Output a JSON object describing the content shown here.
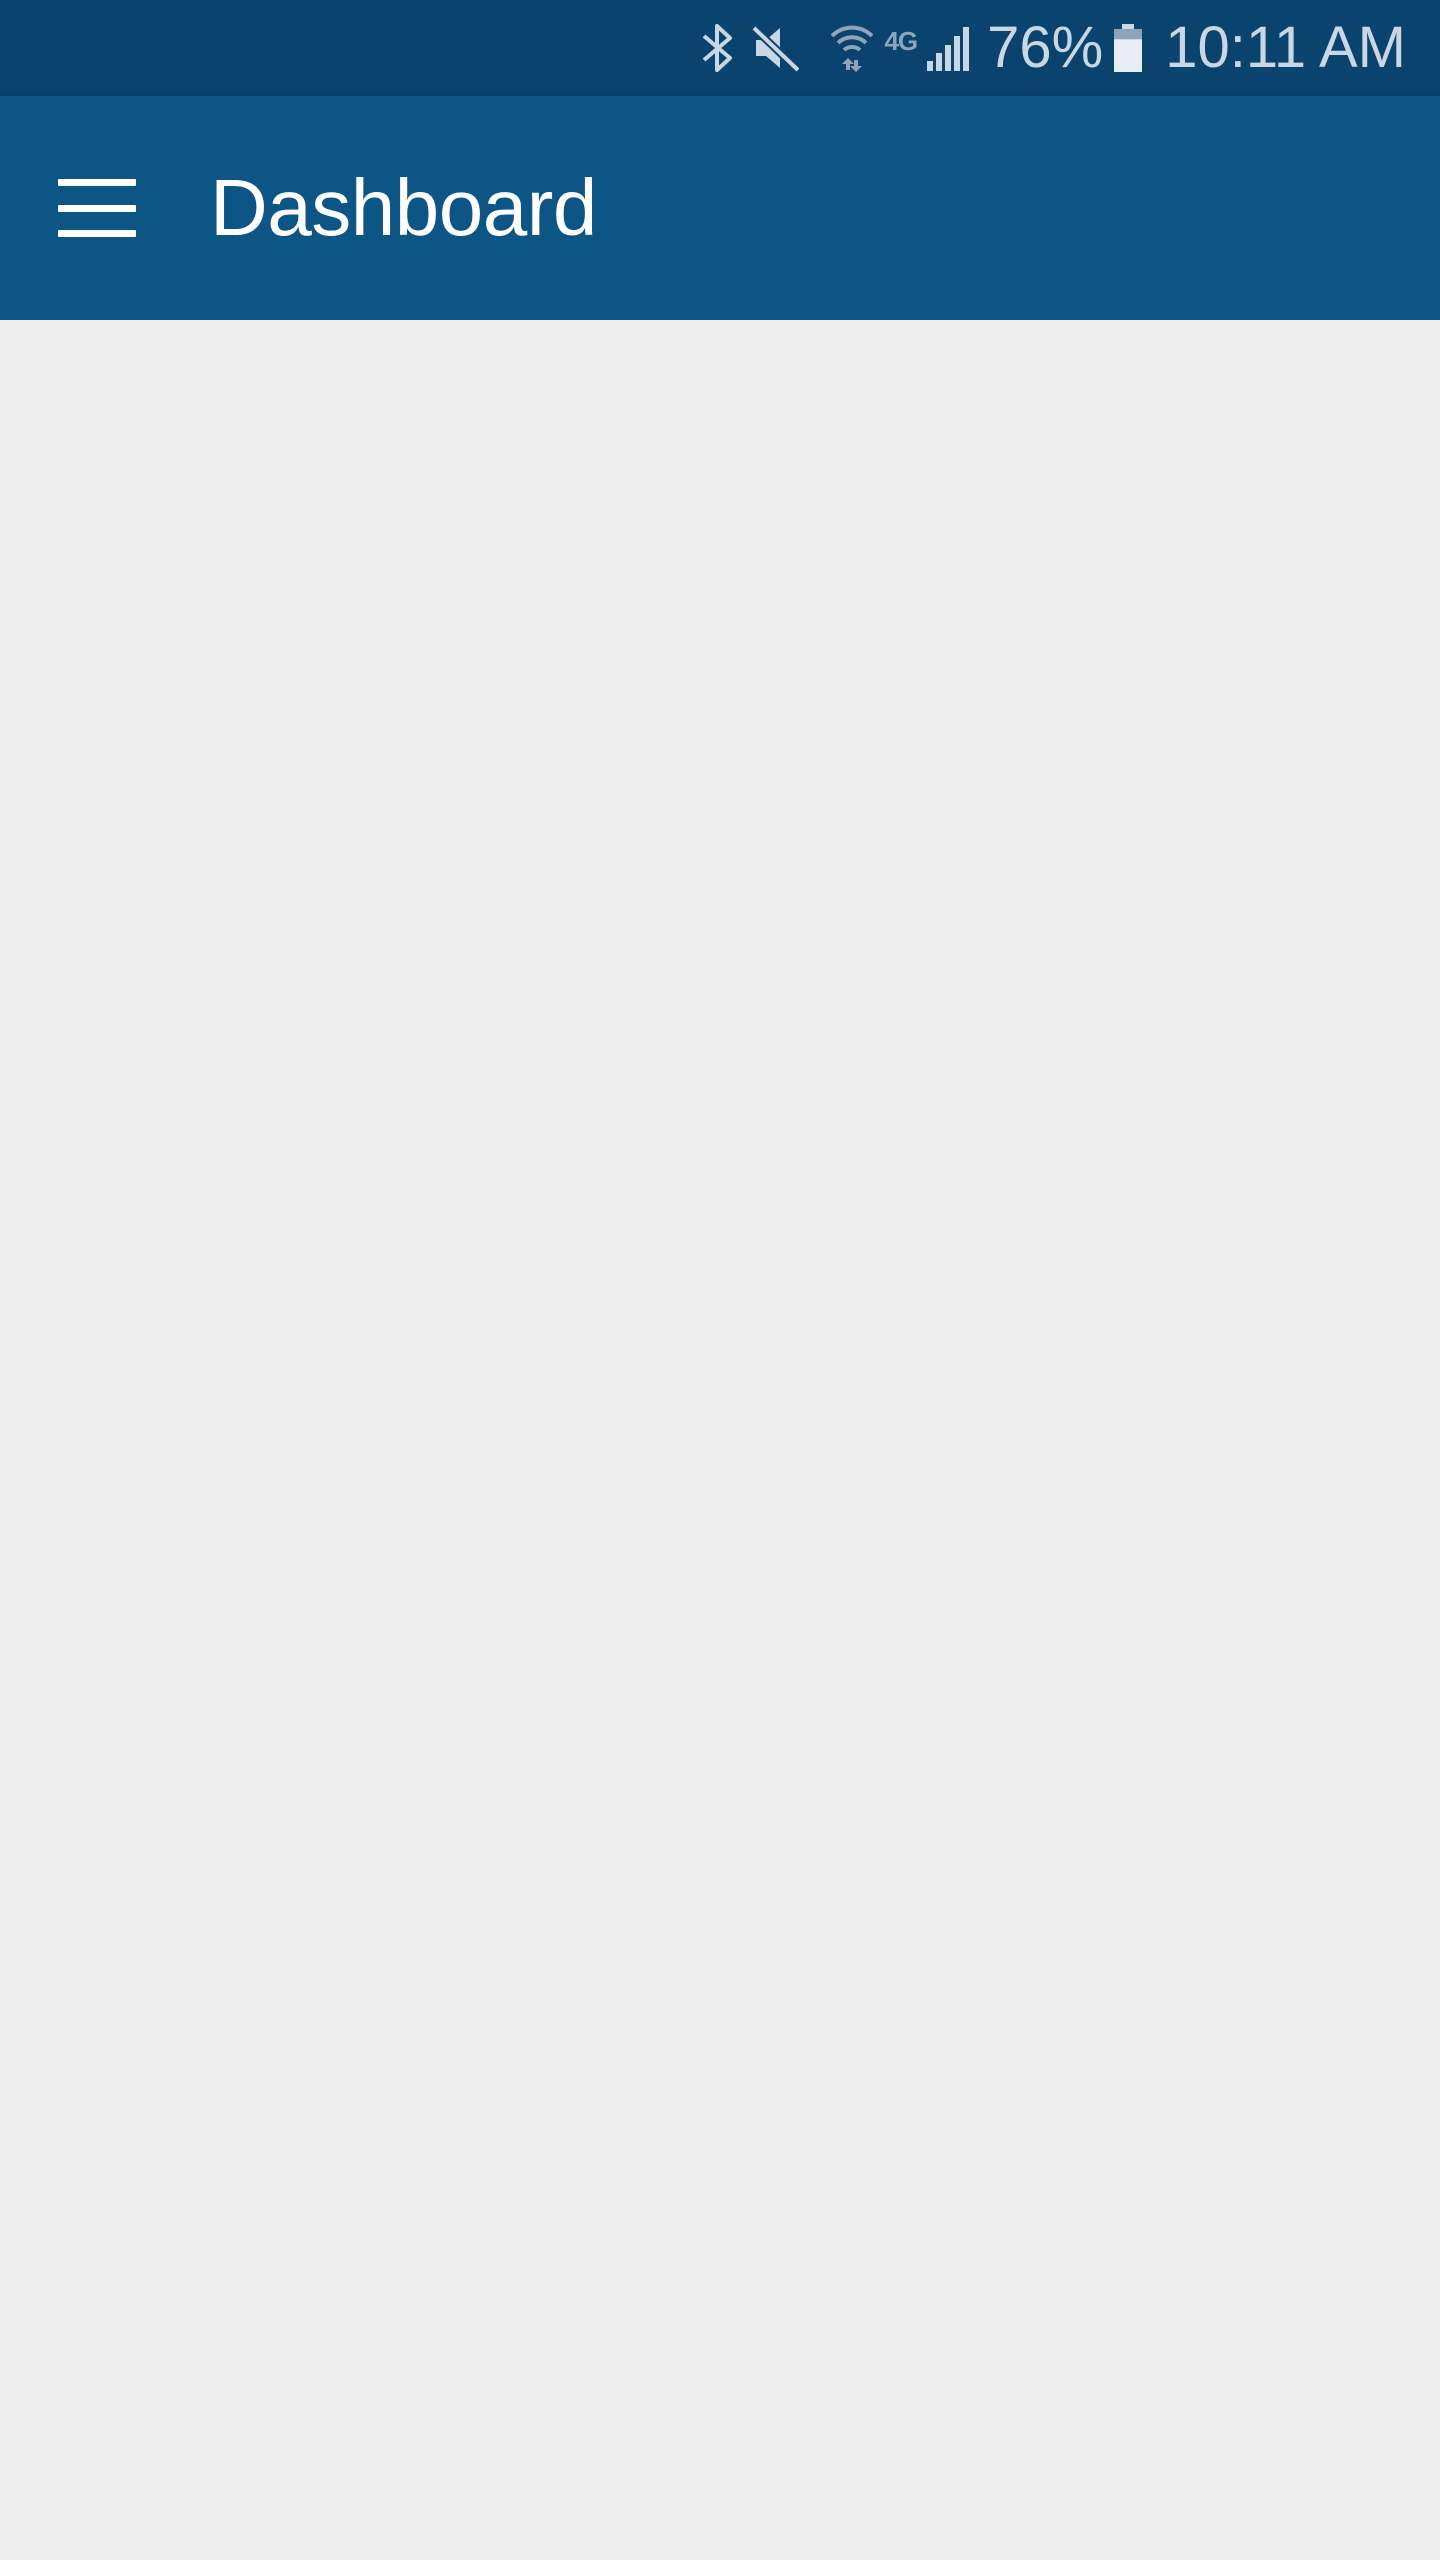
{
  "status_bar": {
    "icons": [
      "bluetooth-icon",
      "mute-icon",
      "wifi-icon",
      "4g-lte-icon",
      "signal-icon",
      "battery-icon"
    ],
    "network_label": "4G",
    "battery_percent": "76%",
    "battery_level": 0.76,
    "time": "10:11 AM"
  },
  "app_bar": {
    "menu_icon": "hamburger-menu-icon",
    "title": "Dashboard"
  },
  "colors": {
    "status_bar_bg": "#0a436d",
    "app_bar_bg": "#0c5585",
    "content_bg": "#eeeeef",
    "status_text": "#c9d6e3",
    "title_text": "#ffffff"
  }
}
